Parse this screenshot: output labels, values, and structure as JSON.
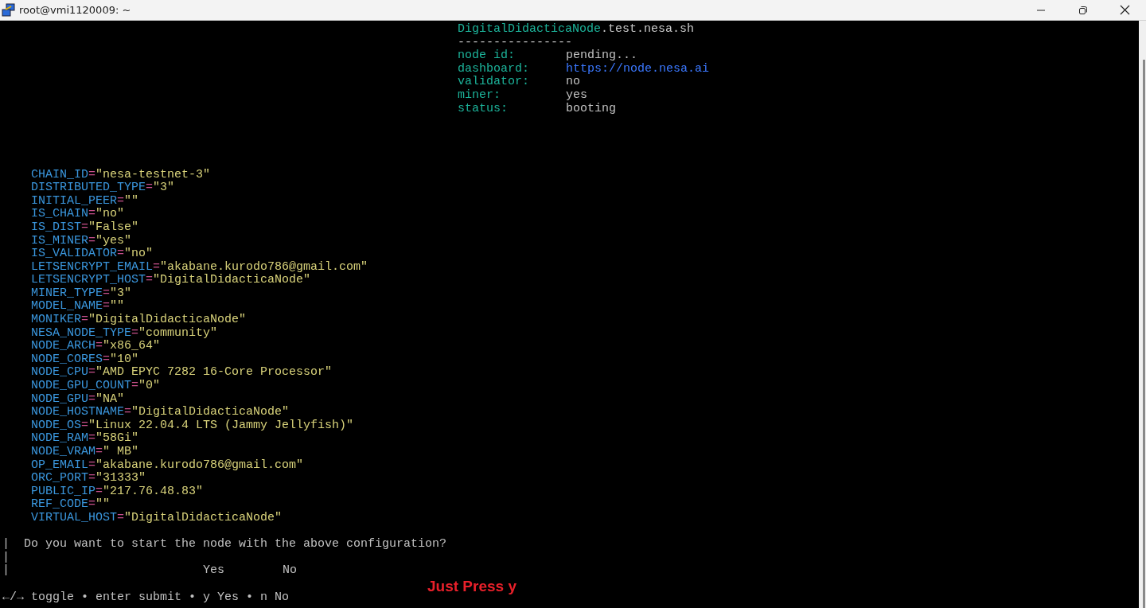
{
  "window": {
    "title": "root@vmi1120009: ~"
  },
  "header": {
    "host": {
      "name": "DigitalDidacticaNode",
      "domain": ".test.nesa.sh"
    },
    "rule": "----------------",
    "fields": [
      {
        "label": "node id:",
        "value": "pending...",
        "kind": "text"
      },
      {
        "label": "dashboard:",
        "value": "https://node.nesa.ai",
        "kind": "link"
      },
      {
        "label": "validator:",
        "value": "no",
        "kind": "text"
      },
      {
        "label": "miner:",
        "value": "yes",
        "kind": "text"
      },
      {
        "label": "status:",
        "value": "booting",
        "kind": "text"
      }
    ]
  },
  "env": [
    {
      "name": "CHAIN_ID",
      "equals": "=",
      "value": "\"nesa-testnet-3\""
    },
    {
      "name": "DISTRIBUTED_TYPE",
      "equals": "=",
      "value": "\"3\""
    },
    {
      "name": "INITIAL_PEER",
      "equals": "=",
      "value": "\"\""
    },
    {
      "name": "IS_CHAIN",
      "equals": "=",
      "value": "\"no\""
    },
    {
      "name": "IS_DIST",
      "equals": "=",
      "value": "\"False\""
    },
    {
      "name": "IS_MINER",
      "equals": "=",
      "value": "\"yes\""
    },
    {
      "name": "IS_VALIDATOR",
      "equals": "=",
      "value": "\"no\""
    },
    {
      "name": "LETSENCRYPT_EMAIL",
      "equals": "=",
      "value": "\"akabane.kurodo786@gmail.com\""
    },
    {
      "name": "LETSENCRYPT_HOST",
      "equals": "=",
      "value": "\"DigitalDidacticaNode\""
    },
    {
      "name": "MINER_TYPE",
      "equals": "=",
      "value": "\"3\""
    },
    {
      "name": "MODEL_NAME",
      "equals": "=",
      "value": "\"\""
    },
    {
      "name": "MONIKER",
      "equals": "=",
      "value": "\"DigitalDidacticaNode\""
    },
    {
      "name": "NESA_NODE_TYPE",
      "equals": "=",
      "value": "\"community\""
    },
    {
      "name": "NODE_ARCH",
      "equals": "=",
      "value": "\"x86_64\""
    },
    {
      "name": "NODE_CORES",
      "equals": "=",
      "value": "\"10\""
    },
    {
      "name": "NODE_CPU",
      "equals": "=",
      "value": "\"AMD EPYC 7282 16-Core Processor\""
    },
    {
      "name": "NODE_GPU_COUNT",
      "equals": "=",
      "value": "\"0\""
    },
    {
      "name": "NODE_GPU",
      "equals": "=",
      "value": "\"NA\""
    },
    {
      "name": "NODE_HOSTNAME",
      "equals": "=",
      "value": "\"DigitalDidacticaNode\""
    },
    {
      "name": "NODE_OS",
      "equals": "=",
      "value": "\"Linux 22.04.4 LTS (Jammy Jellyfish)\""
    },
    {
      "name": "NODE_RAM",
      "equals": "=",
      "value": "\"58Gi\""
    },
    {
      "name": "NODE_VRAM",
      "equals": "=",
      "value": "\" MB\""
    },
    {
      "name": "OP_EMAIL",
      "equals": "=",
      "value": "\"akabane.kurodo786@gmail.com\""
    },
    {
      "name": "ORC_PORT",
      "equals": "=",
      "value": "\"31333\""
    },
    {
      "name": "PUBLIC_IP",
      "equals": "=",
      "value": "\"217.76.48.83\""
    },
    {
      "name": "REF_CODE",
      "equals": "=",
      "value": "\"\""
    },
    {
      "name": "VIRTUAL_HOST",
      "equals": "=",
      "value": "\"DigitalDidacticaNode\""
    }
  ],
  "prompt": {
    "bars": [
      "|",
      "|",
      "|"
    ],
    "question": "Do you want to start the node with the above configuration?",
    "options": [
      "Yes",
      "No"
    ],
    "help": "←/→ toggle • enter submit • y Yes • n No"
  },
  "annotation": "Just Press y"
}
